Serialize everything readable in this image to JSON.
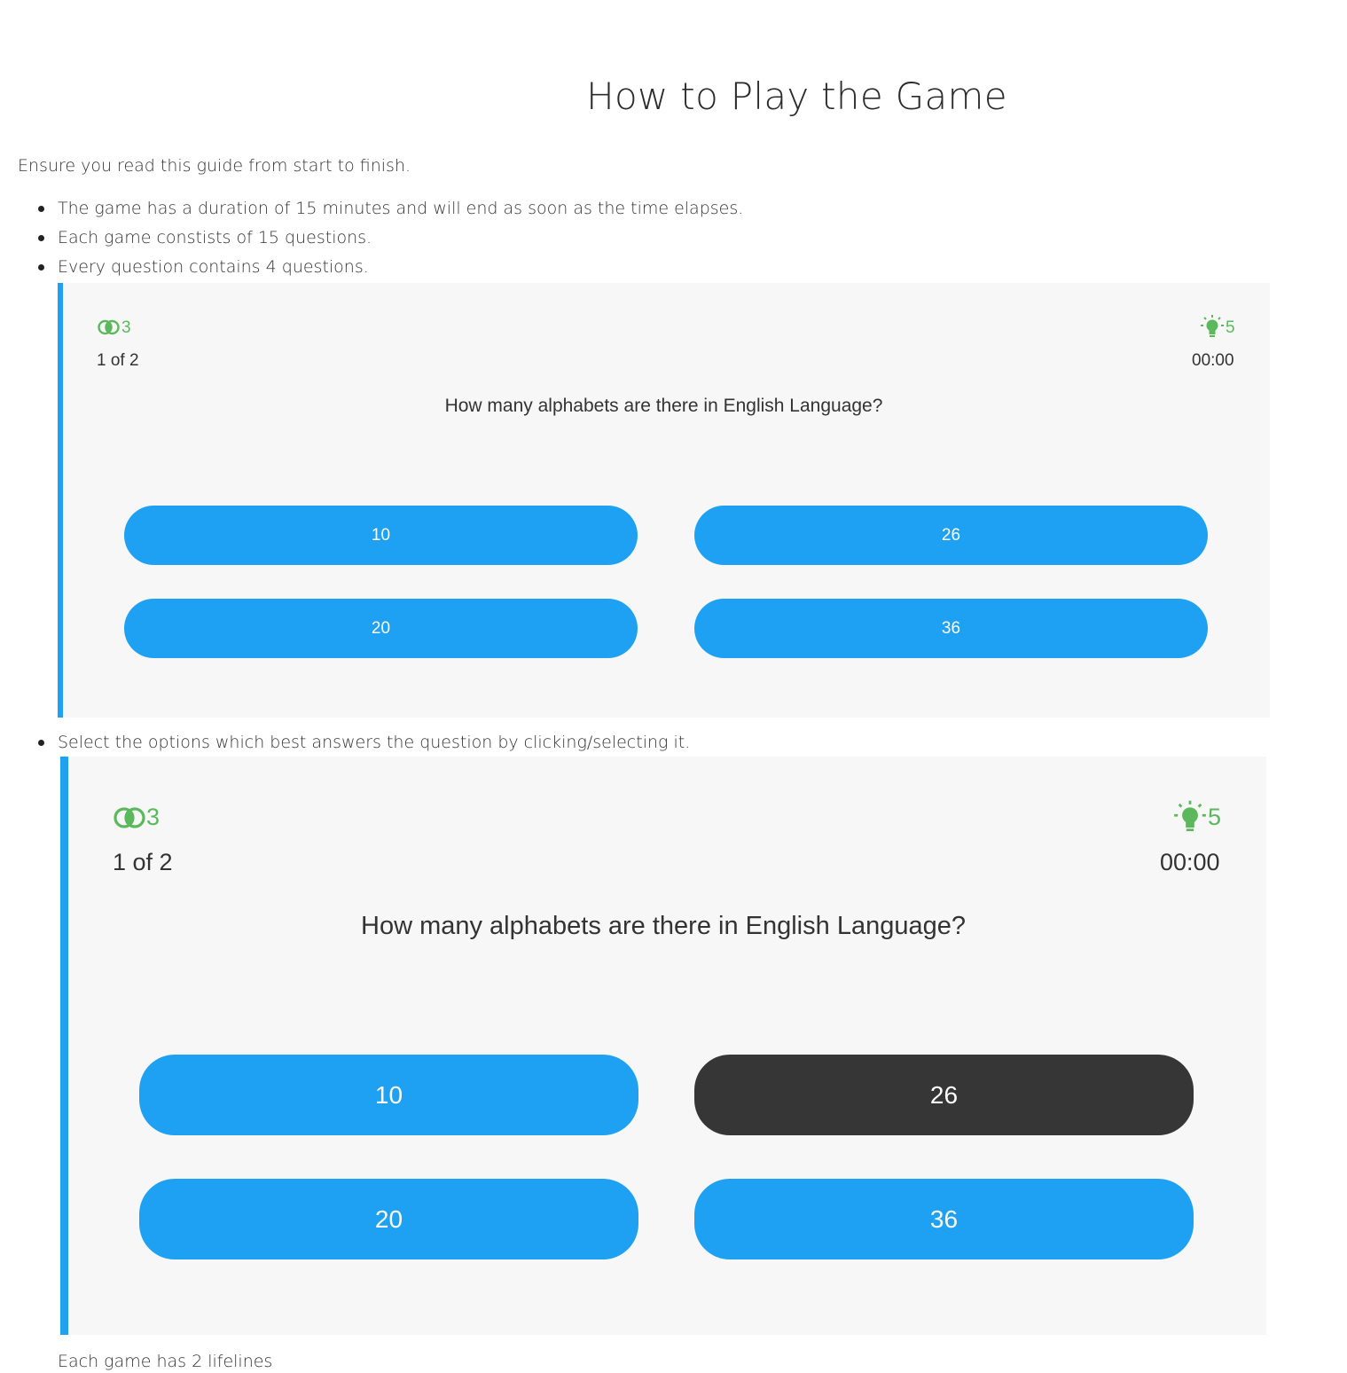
{
  "page": {
    "title": "How to Play the Game",
    "intro": "Ensure you read this guide from start to finish.",
    "bullets": [
      "The game has a duration of 15 minutes and will end as soon as the time elapses.",
      "Each game constists of 15 questions.",
      "Every question contains 4 questions.",
      "Select the options which best answers the question by clicking/selecting it."
    ],
    "partial_bullet": "Each game has 2 lifelines"
  },
  "colors": {
    "accent": "#1ea1f2",
    "selected_option": "#363636",
    "lifeline_green": "#5cb85c",
    "panel_bg": "#f7f7f7"
  },
  "demo1": {
    "fifty_fifty": {
      "icon": "fifty-fifty-icon",
      "count": "3"
    },
    "hints": {
      "icon": "lightbulb-icon",
      "count": "5"
    },
    "progress": "1 of 2",
    "timer": "00:00",
    "question": "How many alphabets are there in English Language?",
    "options": [
      "10",
      "26",
      "20",
      "36"
    ]
  },
  "demo2": {
    "fifty_fifty": {
      "icon": "fifty-fifty-icon",
      "count": "3"
    },
    "hints": {
      "icon": "lightbulb-icon",
      "count": "5"
    },
    "progress": "1 of 2",
    "timer": "00:00",
    "question": "How many alphabets are there in English Language?",
    "options": [
      "10",
      "26",
      "20",
      "36"
    ],
    "selected_option": "26"
  }
}
